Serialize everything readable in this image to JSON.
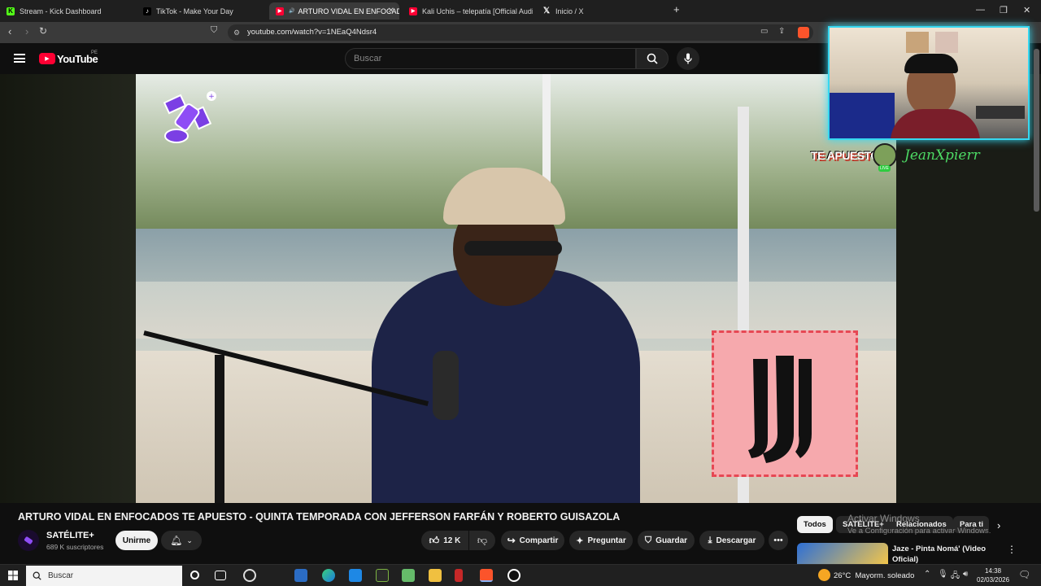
{
  "browser": {
    "tabs": [
      {
        "label": "Stream - Kick Dashboard",
        "icon": "kick-icon",
        "color": "#53fc18"
      },
      {
        "label": "TikTok - Make Your Day",
        "icon": "tiktok-icon",
        "color": "#ffffff"
      },
      {
        "label": "ARTURO VIDAL EN ENFOCAD",
        "icon": "youtube-icon",
        "color": "#ff0033",
        "active": true
      },
      {
        "label": "Kali Uchis – telepatía [Official Audio]",
        "icon": "youtube-icon",
        "color": "#ff0033"
      },
      {
        "label": "Inicio / X",
        "icon": "x-icon",
        "color": "#ffffff"
      }
    ],
    "new_tab": "+",
    "url": "youtube.com/watch?v=1NEaQ4Ndsr4"
  },
  "youtube": {
    "logo_text": "YouTube",
    "region": "PE",
    "search_placeholder": "Buscar"
  },
  "video": {
    "title": "ARTURO VIDAL EN ENFOCADOS TE APUESTO - QUINTA TEMPORADA CON JEFFERSON FARFÁN Y ROBERTO GUISAZOLA",
    "channel": "SATÉLITE+",
    "subscribers": "689 K suscriptores",
    "join_label": "Unirme",
    "likes": "12 K",
    "share_label": "Compartir",
    "ask_label": "Preguntar",
    "save_label": "Guardar",
    "download_label": "Descargar",
    "overlay_brand": "TE APUESTO",
    "overlay_live": "LIVE",
    "streamer_name": "JeanXpierr"
  },
  "sidebar": {
    "chips": [
      "Todos",
      "SATÉLITE+",
      "Relacionados",
      "Para ti"
    ],
    "watermark_line1": "Activar Windows",
    "watermark_line2": "Ve a Configuración para activar Windows.",
    "next_video_title": "Jaze - Pinta Nomá' (Video Oficial)"
  },
  "taskbar": {
    "search_placeholder": "Buscar",
    "weather": "26°C  Mayorm. soleado",
    "time": "14:38",
    "date": "02/03/2026"
  }
}
